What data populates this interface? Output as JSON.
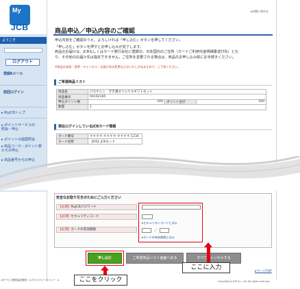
{
  "brand": {
    "logo_top": "My",
    "logo_bottom": "JCB"
  },
  "sidebar": {
    "welcome": "ようこそ",
    "logout": "ログアウト",
    "email": "登録Eメール",
    "prev_login": "前回ログイン",
    "links": [
      "▸ MyJCBトップ",
      "▸ ポイントサービスの\n  照会・申込",
      "▸ ポイントの履歴照会",
      "▸ 商品コース・ポイント数\n  からの申込",
      "▸ 商品番号からの申込"
    ]
  },
  "header": {
    "top_link": "▸お問い合わせ"
  },
  "page": {
    "title": "商品申込／申込内容のご確認",
    "intro_line1": "申込内容をご確認のうえ、よろしければ「申し込む」ボタンを押してください。",
    "intro_line2": "「申し込む」ボタンを押すとお申し込みが完了します。",
    "intro_line3": "商品のお届けは、JCBもしくはカード発行会社に登録の、日本国内のご住所（カードご利用代金明細書送付先）とな",
    "intro_line4": "り、その他のお届け先は指定できません。ご住所を変更される場合は、商品のお申し込み前にお手続きください。",
    "note": "※商品の追加・変更・キャンセル・お届け先の変更などはいたしかねますので、ご了承ください。"
  },
  "order": {
    "section_title": "ご希望商品リスト",
    "rows": [
      {
        "label": "商品名",
        "value": "パスケシン　きき満オリジナルギフトセット"
      },
      {
        "label": "商品番号",
        "value": "00192185"
      },
      {
        "label": "申込ポイント数",
        "value": "200",
        "label2": "ポイント合計",
        "value2": "200"
      },
      {
        "label": "数量",
        "value": "1"
      }
    ]
  },
  "card": {
    "section_title": "現在ログインしているJCBカード情報",
    "rows": [
      {
        "label": "カード番号",
        "value": "＊＊＊＊-＊＊＊＊-＊＊＊＊-1234"
      },
      {
        "label": "カード名称",
        "value": "【OS】JCBカード"
      }
    ]
  },
  "security": {
    "title": "安全なお取り引きのためにご入力ください",
    "required_tag": "【必須】",
    "fields": [
      {
        "label": "MyJCBパスワード"
      },
      {
        "label": "セキュリティコード",
        "link": "▸セキュリティコードとは◎"
      },
      {
        "label": "カードの有効期限",
        "sep": "／",
        "link": "▸カードの有効期限とは◎"
      }
    ]
  },
  "buttons": {
    "apply": "申し込む",
    "back": "ご希望商品リスト画面へ戻る",
    "cancel": "すべてキャンセルする"
  },
  "annotations": {
    "click_here": "ここをクリック",
    "enter_here": "ここに入力"
  },
  "footer": {
    "left": "▸サービス提供会社案内　▸プライバシーポリシー　▸",
    "right": "Copyright(c) JCB Co., Ltd. All rights reserved.",
    "pagetop": "▸ページTOP"
  }
}
